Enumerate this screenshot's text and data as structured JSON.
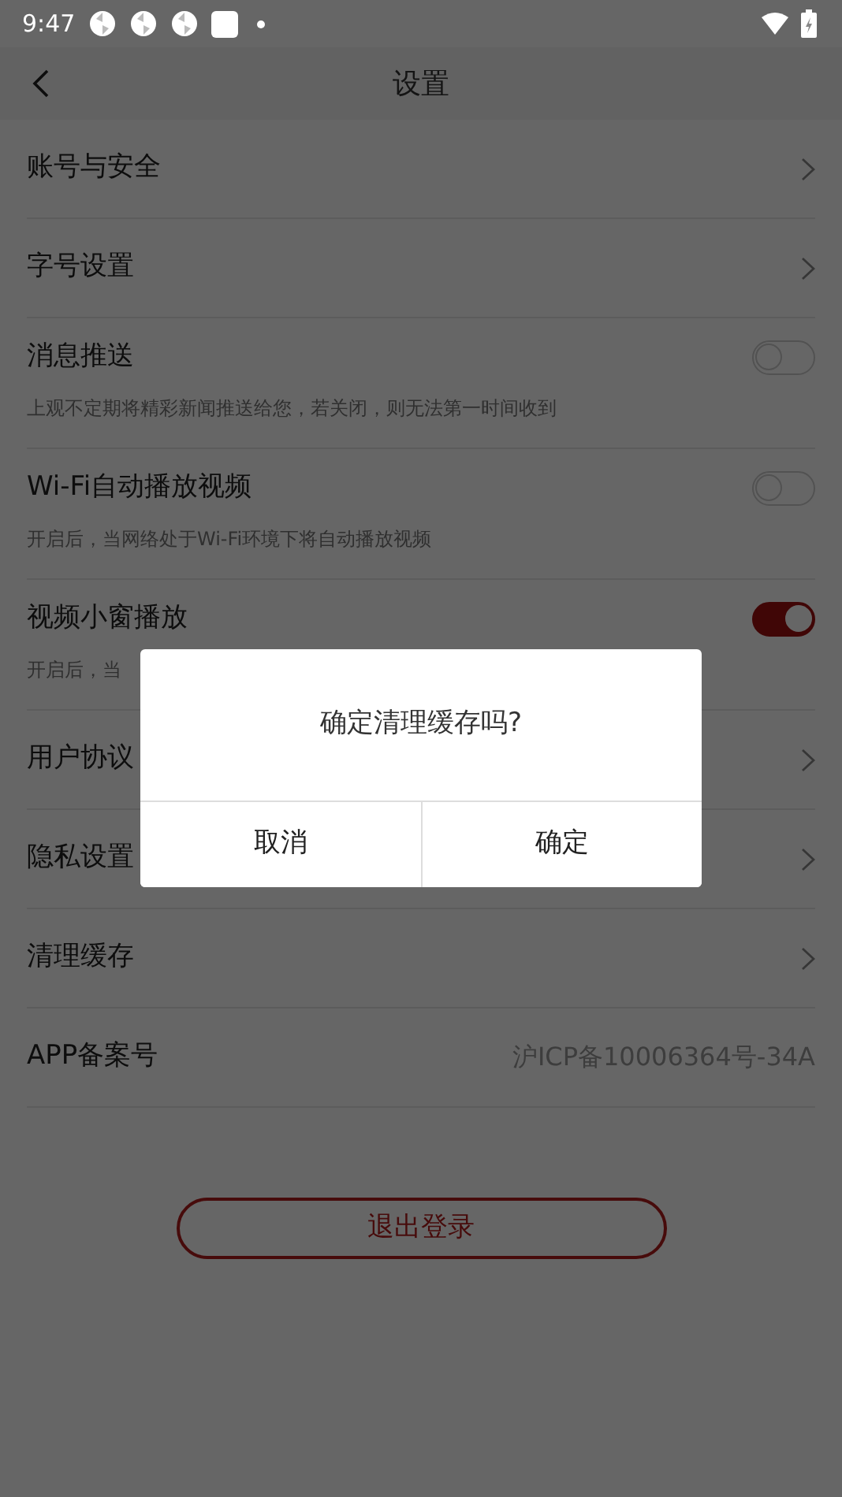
{
  "status_bar": {
    "time": "9:47"
  },
  "header": {
    "title": "设置"
  },
  "settings": [
    {
      "kind": "link",
      "label": "账号与安全"
    },
    {
      "kind": "link",
      "label": "字号设置"
    },
    {
      "kind": "toggle",
      "label": "消息推送",
      "on": false,
      "description": "上观不定期将精彩新闻推送给您，若关闭，则无法第一时间收到"
    },
    {
      "kind": "toggle",
      "label": "Wi-Fi自动播放视频",
      "on": false,
      "description": "开启后，当网络处于Wi-Fi环境下将自动播放视频"
    },
    {
      "kind": "toggle",
      "label": "视频小窗播放",
      "on": true,
      "description": "开启后，当"
    },
    {
      "kind": "link",
      "label": "用户协议"
    },
    {
      "kind": "link",
      "label": "隐私设置"
    },
    {
      "kind": "link",
      "label": "清理缓存"
    },
    {
      "kind": "value",
      "label": "APP备案号",
      "value": "沪ICP备10006364号-34A"
    }
  ],
  "logout_button": "退出登录",
  "dialog": {
    "message": "确定清理缓存吗?",
    "buttons": [
      "取消",
      "确定"
    ]
  }
}
